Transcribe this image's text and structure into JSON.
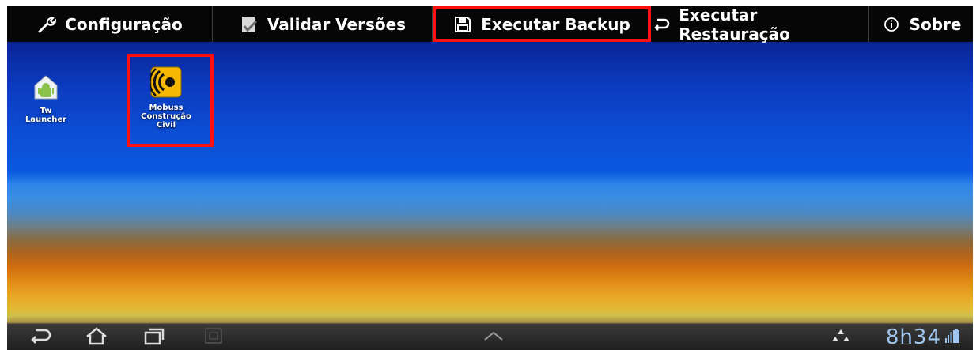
{
  "actionbar": {
    "items": [
      {
        "label": "Configuração",
        "icon": "wrench-icon"
      },
      {
        "label": "Validar Versões",
        "icon": "document-check-icon"
      },
      {
        "label": "Executar Backup",
        "icon": "save-icon"
      },
      {
        "label": "Executar Restauração",
        "icon": "undo-icon"
      },
      {
        "label": "Sobre",
        "icon": "info-icon"
      }
    ]
  },
  "desktop": {
    "icons": [
      {
        "label": "Tw Launcher",
        "icon": "home-android-icon"
      },
      {
        "label": "Mobuss Construção Civil",
        "label_lines": [
          "Mobuss",
          "Construção",
          "Civil"
        ],
        "icon": "mobuss-app-icon"
      }
    ]
  },
  "statusbar": {
    "time": "8h34",
    "icons": [
      "back-icon",
      "home-icon",
      "recent-apps-icon",
      "screenshot-icon",
      "chevron-up-icon",
      "recycle-icon",
      "signal-icon",
      "battery-icon"
    ]
  },
  "colors": {
    "highlight": "#ff1010",
    "clock": "#9fc6ee",
    "actionbar_bg": "#060606"
  }
}
